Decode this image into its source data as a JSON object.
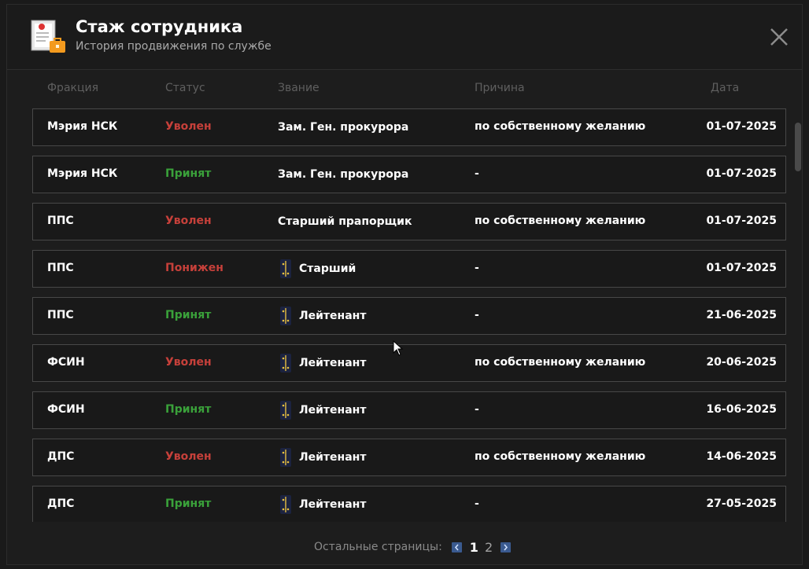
{
  "header": {
    "title": "Стаж сотрудника",
    "subtitle": "История продвижения по службе"
  },
  "columns": {
    "faction": "Фракция",
    "status": "Статус",
    "rank": "Звание",
    "reason": "Причина",
    "date": "Дата"
  },
  "rows": [
    {
      "faction": "Мэрия НСК",
      "status": "Уволен",
      "status_kind": "fired",
      "rank": "Зам. Ген. прокурора",
      "insignia": false,
      "reason": "по собственному желанию",
      "date": "01-07-2025"
    },
    {
      "faction": "Мэрия НСК",
      "status": "Принят",
      "status_kind": "hired",
      "rank": "Зам. Ген. прокурора",
      "insignia": false,
      "reason": "-",
      "date": "01-07-2025"
    },
    {
      "faction": "ППС",
      "status": "Уволен",
      "status_kind": "fired",
      "rank": "Старший прапорщик",
      "insignia": false,
      "reason": "по собственному желанию",
      "date": "01-07-2025"
    },
    {
      "faction": "ППС",
      "status": "Понижен",
      "status_kind": "demoted",
      "rank": "Старший",
      "insignia": true,
      "reason": "-",
      "date": "01-07-2025"
    },
    {
      "faction": "ППС",
      "status": "Принят",
      "status_kind": "hired",
      "rank": "Лейтенант",
      "insignia": true,
      "reason": "-",
      "date": "21-06-2025"
    },
    {
      "faction": "ФСИН",
      "status": "Уволен",
      "status_kind": "fired",
      "rank": "Лейтенант",
      "insignia": true,
      "reason": "по собственному желанию",
      "date": "20-06-2025"
    },
    {
      "faction": "ФСИН",
      "status": "Принят",
      "status_kind": "hired",
      "rank": "Лейтенант",
      "insignia": true,
      "reason": "-",
      "date": "16-06-2025"
    },
    {
      "faction": "ДПС",
      "status": "Уволен",
      "status_kind": "fired",
      "rank": "Лейтенант",
      "insignia": true,
      "reason": "по собственному желанию",
      "date": "14-06-2025"
    },
    {
      "faction": "ДПС",
      "status": "Принят",
      "status_kind": "hired",
      "rank": "Лейтенант",
      "insignia": true,
      "reason": "-",
      "date": "27-05-2025"
    }
  ],
  "pager": {
    "label": "Остальные страницы:",
    "pages": [
      "1",
      "2"
    ],
    "current": "1"
  },
  "colors": {
    "fired": "#c6403a",
    "hired": "#3aa13a",
    "demoted": "#c6403a",
    "accent": "#3a5a8f"
  },
  "icons": {
    "header": "employee-record-icon",
    "close": "close-icon",
    "insignia": "shoulder-strap-icon",
    "prev": "chevron-left-icon",
    "next": "chevron-right-icon"
  }
}
